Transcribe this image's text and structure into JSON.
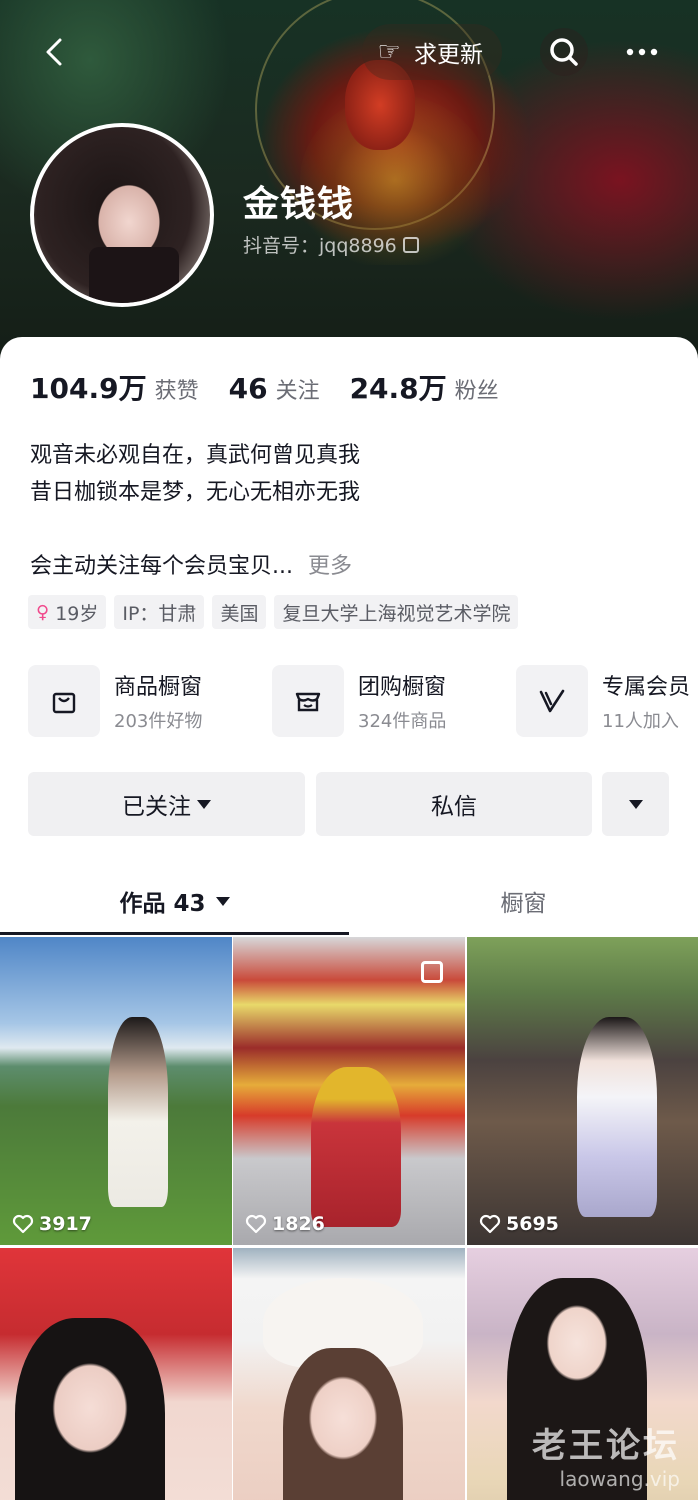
{
  "header": {
    "request_update_label": "求更新",
    "nickname": "金钱钱",
    "douyin_id": "抖音号：jqq8896"
  },
  "stats": [
    {
      "value": "104.9万",
      "label": "获赞"
    },
    {
      "value": "46",
      "label": "关注"
    },
    {
      "value": "24.8万",
      "label": "粉丝"
    }
  ],
  "bio": {
    "line1": "观音未必观自在，真武何曾见真我",
    "line2": "昔日枷锁本是梦，无心无相亦无我",
    "line3": "会主动关注每个会员宝贝...",
    "more_label": "更多"
  },
  "tags": {
    "age": "19岁",
    "ip": "IP：甘肃",
    "location": "美国",
    "school": "复旦大学上海视觉艺术学院"
  },
  "shops": [
    {
      "title": "商品橱窗",
      "sub": "203件好物",
      "icon": "shopping-bag-icon"
    },
    {
      "title": "团购橱窗",
      "sub": "324件商品",
      "icon": "store-icon"
    },
    {
      "title": "专属会员",
      "sub": "11人加入",
      "icon": "vip-v-icon"
    }
  ],
  "actions": {
    "followed_label": "已关注",
    "message_label": "私信"
  },
  "tabs": {
    "works_label": "作品 43",
    "showcase_label": "橱窗"
  },
  "videos": [
    {
      "likes": "3917"
    },
    {
      "likes": "1826"
    },
    {
      "likes": "5695"
    },
    {
      "likes": ""
    },
    {
      "likes": ""
    },
    {
      "likes": ""
    }
  ],
  "watermark": {
    "line1": "老王论坛",
    "line2": "laowang.vip"
  },
  "colors": {
    "text_primary": "#161823",
    "text_secondary": "#6b6d75",
    "tag_bg": "#f2f2f4",
    "button_bg": "#f0f0f2",
    "gender_pink": "#f04a8c"
  }
}
